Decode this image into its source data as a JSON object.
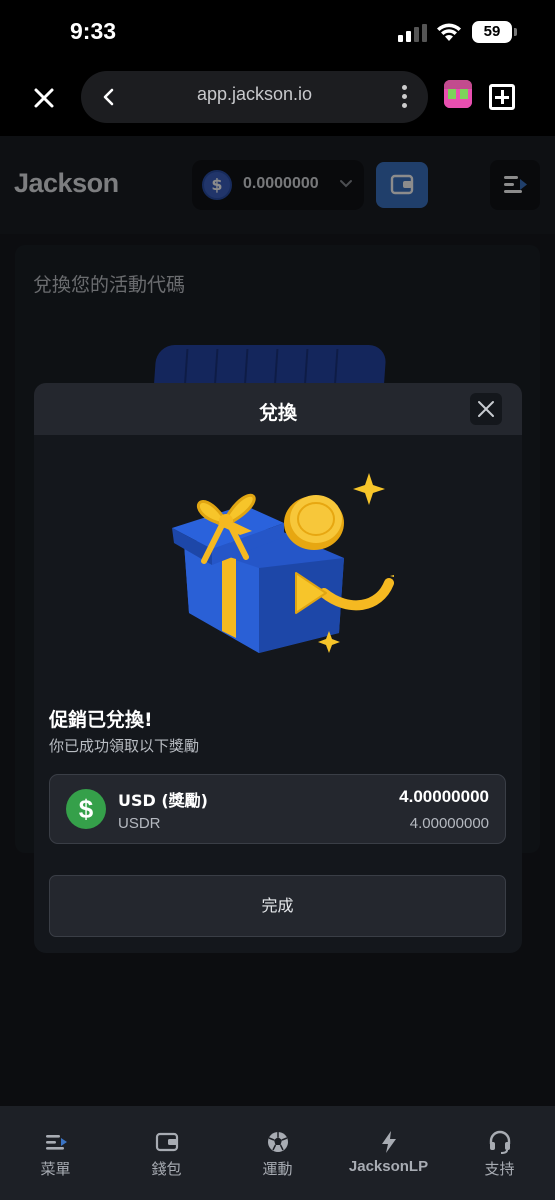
{
  "status_bar": {
    "time": "9:33",
    "battery": "59"
  },
  "browser": {
    "url": "app.jackson.io"
  },
  "header": {
    "logo": "Jackson",
    "balance": "0.0000000",
    "currency_symbol": "$"
  },
  "page": {
    "title": "兌換您的活動代碼"
  },
  "modal": {
    "title": "兌換",
    "promo_title": "促銷已兌換!",
    "promo_subtitle": "你已成功領取以下獎勵",
    "reward": {
      "icon_symbol": "$",
      "name": "USD (獎勵)",
      "code": "USDR",
      "amount": "4.00000000",
      "amount_sub": "4.00000000"
    },
    "done_label": "完成"
  },
  "bottom_nav": {
    "items": [
      {
        "label": "菜單",
        "icon": "menu-icon"
      },
      {
        "label": "錢包",
        "icon": "wallet-icon"
      },
      {
        "label": "運動",
        "icon": "soccer-ball-icon"
      },
      {
        "label": "JacksonLP",
        "icon": "lightning-icon"
      },
      {
        "label": "支持",
        "icon": "headset-icon"
      }
    ]
  },
  "colors": {
    "accent_blue": "#3b74c4",
    "success_green": "#35a04a",
    "modal_bg": "#14171c",
    "header_bg": "#1b1e24"
  }
}
